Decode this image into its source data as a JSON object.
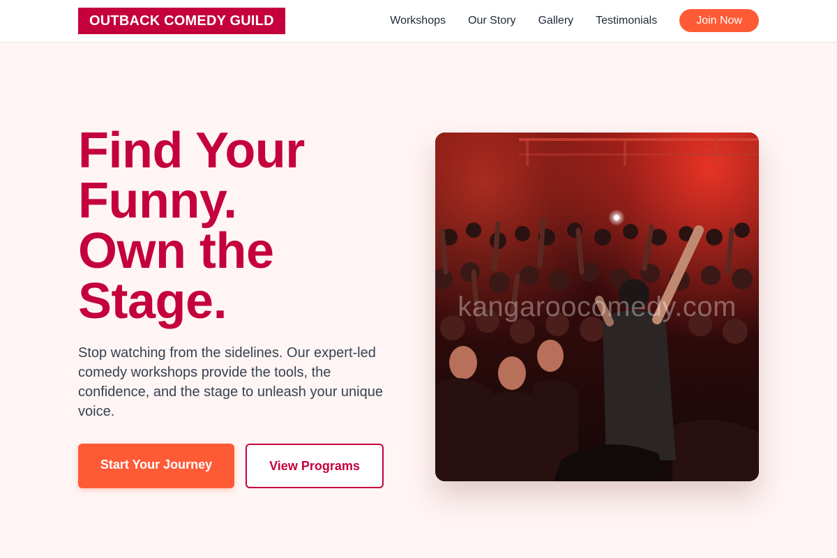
{
  "header": {
    "logo": "OUTBACK COMEDY GUILD",
    "nav": [
      "Workshops",
      "Our Story",
      "Gallery",
      "Testimonials"
    ],
    "cta": "Join Now"
  },
  "hero": {
    "title_lines": [
      "Find Your",
      "Funny.",
      "Own the",
      "Stage."
    ],
    "description": "Stop watching from the sidelines. Our expert-led comedy workshops provide the tools, the confidence, and the stage to unleash your unique voice.",
    "primary_button": "Start Your Journey",
    "secondary_button": "View Programs",
    "image_watermark": "kangaroocomedy.com"
  },
  "colors": {
    "brand": "#c4003d",
    "accent": "#ff5a36",
    "background": "#fff5f4"
  }
}
